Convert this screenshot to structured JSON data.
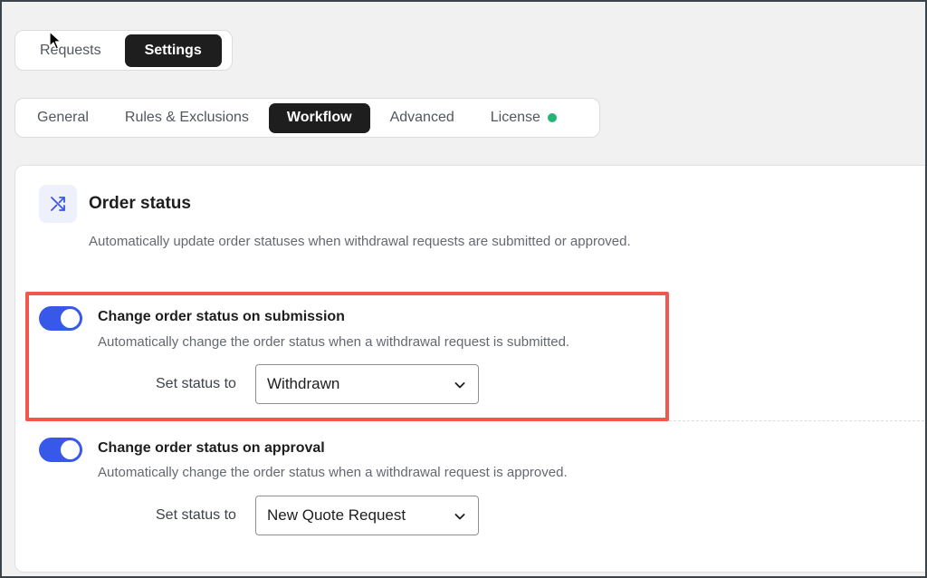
{
  "top_tabs": [
    {
      "label": "Requests",
      "active": false
    },
    {
      "label": "Settings",
      "active": true
    }
  ],
  "settings_tabs": [
    {
      "label": "General",
      "active": false
    },
    {
      "label": "Rules & Exclusions",
      "active": false
    },
    {
      "label": "Workflow",
      "active": true
    },
    {
      "label": "Advanced",
      "active": false
    },
    {
      "label": "License",
      "active": false
    }
  ],
  "license_status_color": "#22b573",
  "section": {
    "icon": "shuffle-icon",
    "title": "Order status",
    "description": "Automatically update order statuses when withdrawal requests are submitted or approved."
  },
  "options": [
    {
      "title": "Change order status on submission",
      "description": "Automatically change the order status when a withdrawal request is submitted.",
      "enabled": true,
      "set_label": "Set status to",
      "value": "Withdrawn"
    },
    {
      "title": "Change order status on approval",
      "description": "Automatically change the order status when a withdrawal request is approved.",
      "enabled": true,
      "set_label": "Set status to",
      "value": "New Quote Request"
    }
  ],
  "colors": {
    "accent": "#3858e9",
    "highlight": "#f1574f",
    "dark": "#1e1e1e"
  }
}
